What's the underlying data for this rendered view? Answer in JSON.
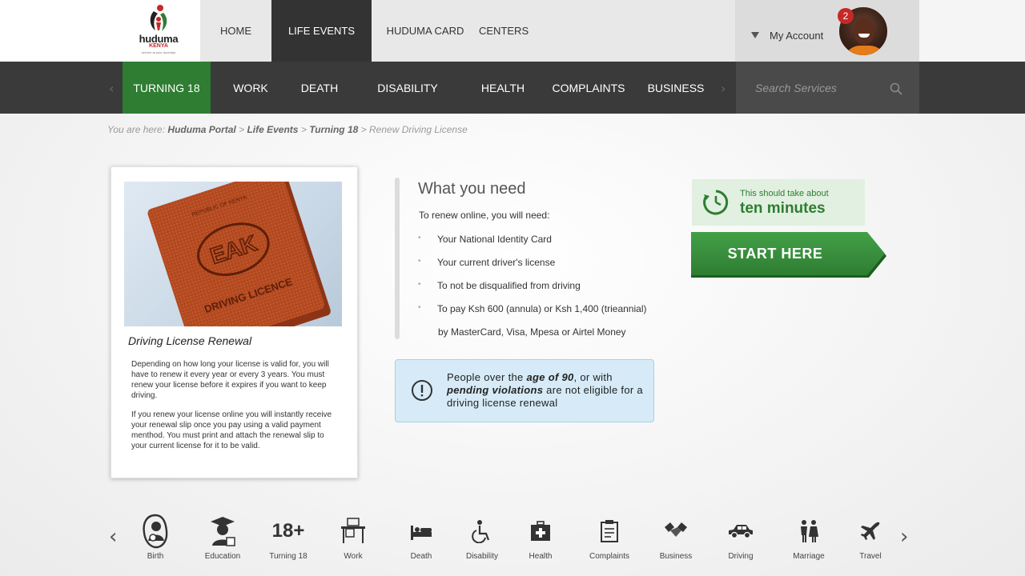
{
  "header": {
    "logo": {
      "word": "huduma",
      "sub": "KENYA",
      "tag": "service at your doorstep"
    },
    "nav": [
      {
        "label": "HOME",
        "active": false
      },
      {
        "label": "LIFE EVENTS",
        "active": true
      },
      {
        "label": "HUDUMA CARD",
        "active": false
      },
      {
        "label": "CENTERS",
        "active": false
      }
    ],
    "account": {
      "label": "My Account",
      "notifications": "2"
    }
  },
  "subnav": {
    "items": [
      {
        "label": "TURNING 18",
        "active": true
      },
      {
        "label": "WORK",
        "active": false
      },
      {
        "label": "DEATH",
        "active": false
      },
      {
        "label": "DISABILITY",
        "active": false
      },
      {
        "label": "HEALTH",
        "active": false
      },
      {
        "label": "COMPLAINTS",
        "active": false
      },
      {
        "label": "BUSINESS",
        "active": false
      }
    ],
    "search_placeholder": "Search Services"
  },
  "breadcrumb": {
    "prefix": "You are here:",
    "links": [
      "Huduma Portal",
      "Life Events",
      "Turning 18"
    ],
    "current": "Renew Driving License",
    "separator": ">"
  },
  "card": {
    "image_text": {
      "top": "REPUBLIC OF KENYA",
      "middle": "EAK",
      "bottom": "DRIVING LICENCE"
    },
    "title": "Driving License Renewal",
    "paragraphs": [
      "Depending on how long your license is valid for, you will have to renew it every year or every 3 years. You must renew your license before it expires if you want to keep driving.",
      "If you renew your license online you will instantly receive your renewal slip once you pay using a valid payment menthod. You must print and attach the renewal slip to your current license for it to be valid."
    ]
  },
  "requirements": {
    "title": "What you need",
    "intro": "To renew online, you will need:",
    "items": [
      "Your National Identity Card",
      "Your current driver's license",
      "To not be disqualified from driving",
      "To pay Ksh 600 (annula) or Ksh 1,400 (trieannial)"
    ],
    "continuation": "by MasterCard, Visa, Mpesa or Airtel Money"
  },
  "notice": {
    "part1": "People over the ",
    "bold1": "age of 90",
    "part2": ", or with ",
    "bold2": "pending violations",
    "part3": " are not eligible for a driving license renewal"
  },
  "time": {
    "label": "This should take about",
    "value": "ten minutes"
  },
  "start_button": "START HERE",
  "categories": [
    {
      "label": "Birth",
      "icon": "mother-child-icon"
    },
    {
      "label": "Education",
      "icon": "graduate-icon"
    },
    {
      "label": "Turning 18",
      "icon": "18-plus-icon",
      "glyph": "18+"
    },
    {
      "label": "Work",
      "icon": "desk-icon"
    },
    {
      "label": "Death",
      "icon": "hospital-bed-icon"
    },
    {
      "label": "Disability",
      "icon": "wheelchair-icon"
    },
    {
      "label": "Health",
      "icon": "first-aid-icon"
    },
    {
      "label": "Complaints",
      "icon": "clipboard-icon"
    },
    {
      "label": "Business",
      "icon": "handshake-icon"
    },
    {
      "label": "Driving",
      "icon": "car-icon"
    },
    {
      "label": "Marriage",
      "icon": "couple-icon"
    },
    {
      "label": "Travel",
      "icon": "airplane-icon"
    }
  ],
  "colors": {
    "brand_green": "#2e7d32",
    "dark_nav": "#3a3a3a",
    "notice_blue": "#d6ebf7",
    "badge_red": "#c62828"
  }
}
